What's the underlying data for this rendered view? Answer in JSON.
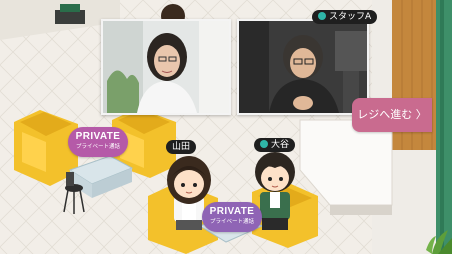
{
  "participants": {
    "staff": {
      "name": "スタッフA"
    },
    "yamada": {
      "name": "山田"
    },
    "otani": {
      "name": "大谷"
    }
  },
  "rooms": {
    "left": {
      "title": "PRIVATE",
      "subtitle": "プライベート通話",
      "color": "#b55aa8"
    },
    "center": {
      "title": "PRIVATE",
      "subtitle": "プライベート通話",
      "color": "#8f64b5"
    }
  },
  "checkout_button": {
    "label": "レジへ進む 〉"
  },
  "colors": {
    "floor": "#f1ede6",
    "sofa": "#f3c12b",
    "accent": "#c96b8f",
    "status_online": "#2fb6a8"
  }
}
